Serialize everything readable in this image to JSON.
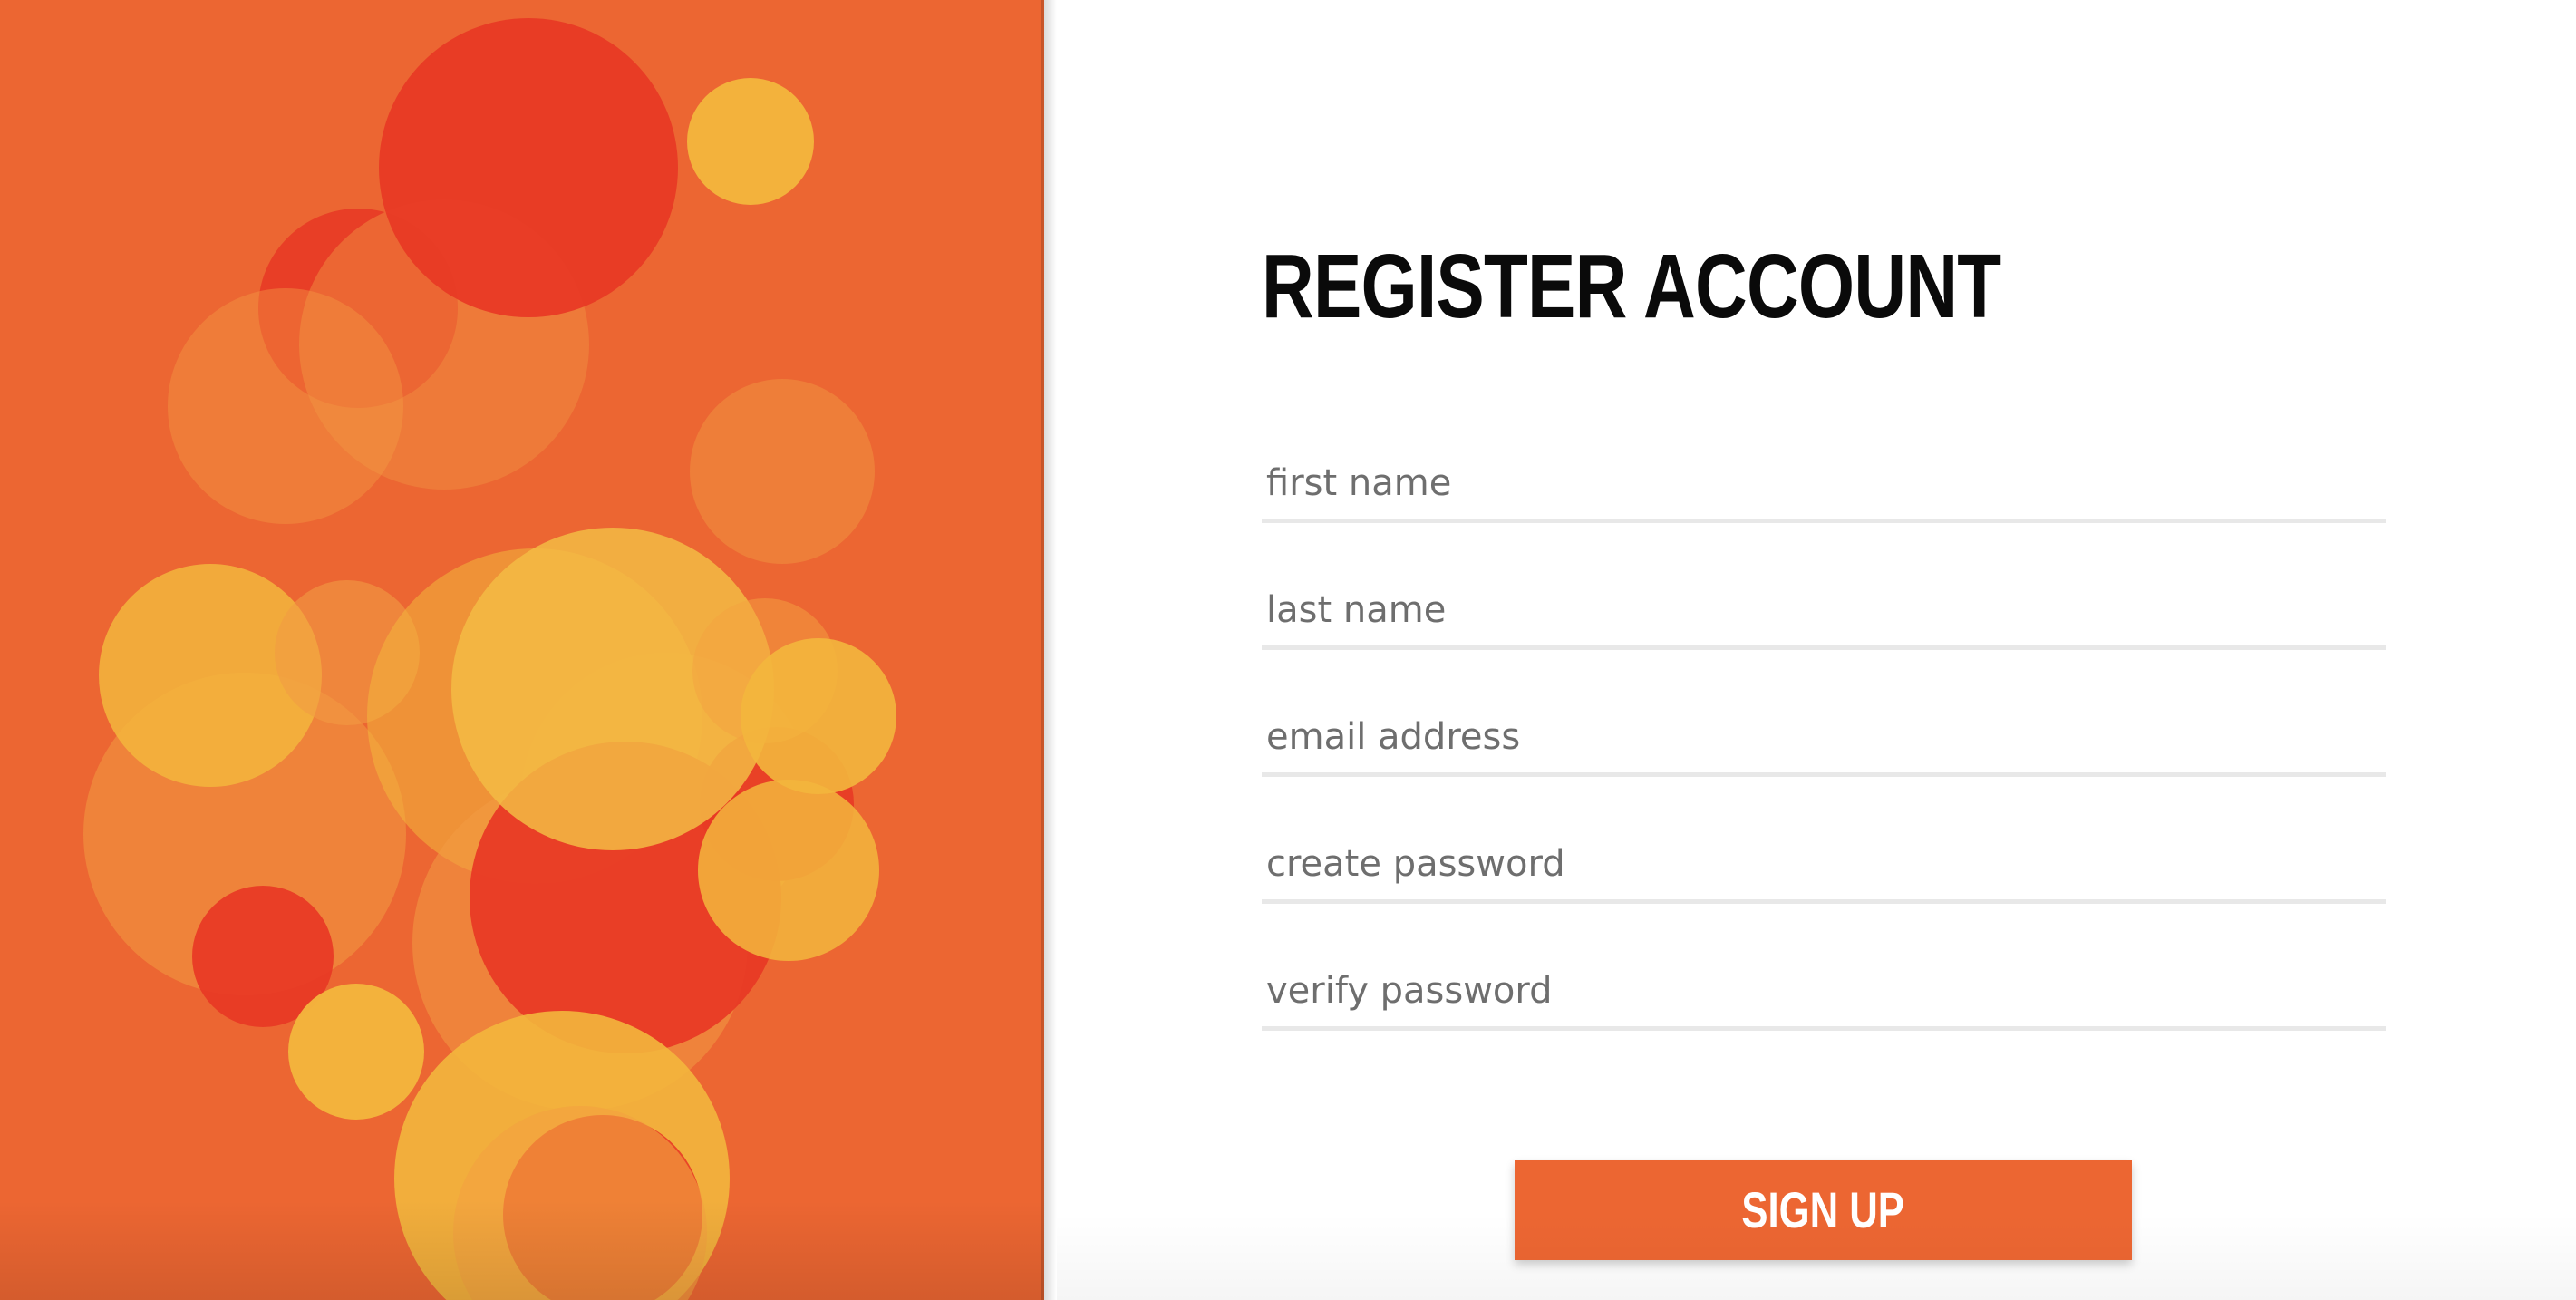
{
  "page": {
    "title": "REGISTER ACCOUNT"
  },
  "form": {
    "fields": [
      {
        "name": "first-name",
        "placeholder": "first name",
        "value": ""
      },
      {
        "name": "last-name",
        "placeholder": "last name",
        "value": ""
      },
      {
        "name": "email-address",
        "placeholder": "email address",
        "value": ""
      },
      {
        "name": "create-password",
        "placeholder": "create password",
        "value": ""
      },
      {
        "name": "verify-password",
        "placeholder": "verify password",
        "value": ""
      }
    ],
    "submit_label": "SIGN UP"
  },
  "theme": {
    "brand_orange": "#ec6632",
    "accent_red": "#e83a25",
    "accent_yellow": "#f3b63d",
    "heading_color": "#0a0a0a",
    "field_underline": "#e8e8e8"
  }
}
